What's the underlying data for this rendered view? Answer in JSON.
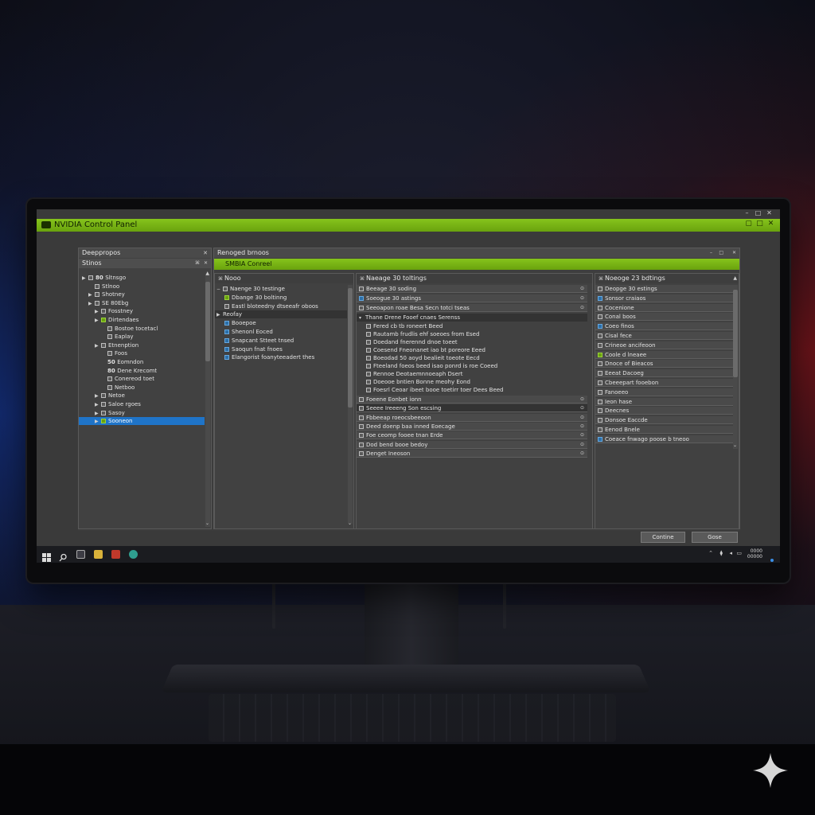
{
  "window": {
    "title": "NVIDIA Control Panel"
  },
  "left_panel": {
    "header": "Deeppropos",
    "sub_header": "Stinos",
    "items": [
      {
        "label": "Sltnsgo",
        "indent": 0,
        "expander": "▶",
        "num": "80",
        "icon": "n"
      },
      {
        "label": "Stlnoo",
        "indent": 1,
        "expander": "",
        "num": "",
        "icon": "n"
      },
      {
        "label": "Shotney",
        "indent": 1,
        "expander": "▶",
        "num": "",
        "icon": "n"
      },
      {
        "label": "SE 80Ebg",
        "indent": 1,
        "expander": "▶",
        "num": "",
        "icon": "n"
      },
      {
        "label": "Fosstney",
        "indent": 2,
        "expander": "▶",
        "num": "",
        "icon": "n"
      },
      {
        "label": "Dirtendaes",
        "indent": 2,
        "expander": "▶",
        "num": "",
        "icon": "g"
      },
      {
        "label": "Bostoe tocetacl",
        "indent": 3,
        "expander": "",
        "num": "",
        "icon": "n"
      },
      {
        "label": "Eaplay",
        "indent": 3,
        "expander": "",
        "num": "",
        "icon": "n"
      },
      {
        "label": "Etnenption",
        "indent": 2,
        "expander": "▶",
        "num": "",
        "icon": "n"
      },
      {
        "label": "Foos",
        "indent": 3,
        "expander": "",
        "num": "",
        "icon": "n"
      },
      {
        "label": "Eomndon",
        "indent": 3,
        "expander": "",
        "num": "50",
        "icon": ""
      },
      {
        "label": "Dene Krecomt",
        "indent": 3,
        "expander": "",
        "num": "80",
        "icon": ""
      },
      {
        "label": "Conereod toet",
        "indent": 3,
        "expander": "",
        "num": "",
        "icon": "n"
      },
      {
        "label": "Netboo",
        "indent": 3,
        "expander": "",
        "num": "",
        "icon": "n"
      },
      {
        "label": "Netoe",
        "indent": 2,
        "expander": "▶",
        "num": "",
        "icon": "n"
      },
      {
        "label": "Saloe rgoes",
        "indent": 2,
        "expander": "▶",
        "num": "",
        "icon": "n"
      },
      {
        "label": "Sasoy",
        "indent": 2,
        "expander": "▶",
        "num": "",
        "icon": "n"
      },
      {
        "label": "Sooneon",
        "indent": 2,
        "expander": "▶",
        "num": "",
        "icon": "g",
        "selected": true
      }
    ]
  },
  "tab_strip": {
    "label": "Renoged brnoos"
  },
  "green_header": {
    "label": "SMBIA Conreel"
  },
  "col1": {
    "header": "Nooo",
    "items": [
      {
        "label": "Naenge 30 testinge",
        "icon": "n",
        "exp": "−"
      },
      {
        "label": "Dbange 30 boltinng",
        "icon": "g",
        "exp": ""
      },
      {
        "label": "Eastl bloteedny dtseeafr oboos",
        "icon": "n",
        "exp": ""
      },
      {
        "label": "Reofay",
        "icon": "",
        "exp": "▶",
        "hl": true
      },
      {
        "label": "Booepoe",
        "icon": "b",
        "exp": ""
      },
      {
        "label": "Shenonl Eoced",
        "icon": "b",
        "exp": ""
      },
      {
        "label": "Snapcant Stteet tnsed",
        "icon": "b",
        "exp": ""
      },
      {
        "label": "Saoqun fnat fnoes",
        "icon": "b",
        "exp": ""
      },
      {
        "label": "Elangorist foanyteeadert thes",
        "icon": "b",
        "exp": ""
      }
    ]
  },
  "col2": {
    "header": "Naeage 30 toltings",
    "bands": [
      "Beeage 30 soding",
      "Soeogue 30 astings",
      "Seeoapon roae Besa Secn totci tseas"
    ],
    "section_header": "Thane Drene Fooef cnaes Serenss",
    "sub_items": [
      "Fered cb tb roneert Beed",
      "Rautamb frudlis ehf soeoes from Esed",
      "Doedand fnerennd dnoe toeet",
      "Coesend Fneonanet iao bt poreore Eeed",
      "Boeodad 50 aoyd bealieit toeote Eecd",
      "Fteeland foeos beed isao ponrd is roe Coeed",
      "Rennoe Deotaemnnoeaph Dsert",
      "Doeooe bntien Bonne meohy Eond",
      "Foesrl Ceoar ibeet booe toetirr toer Dees Beed"
    ],
    "bands2": [
      "Foeene Eonbet ionn",
      "Seeee Ireeeng Son escsing",
      "Fbbeeap roeocsbeeoon",
      "Deed doenp baa inned Eoecage",
      "Foe ceomp fooee tnan Erde",
      "Dod bend booe bedoy",
      "Denget Ineoson"
    ]
  },
  "col3": {
    "header": "Noeoge 23 bdtings",
    "items": [
      {
        "label": "Deopge 30 estings",
        "icon": "n"
      },
      {
        "label": "Sonsor craiaos",
        "icon": "b"
      },
      {
        "label": "Cocenione",
        "icon": "n"
      },
      {
        "label": "Conal boos",
        "icon": "n"
      },
      {
        "label": "Coeo finos",
        "icon": "b"
      },
      {
        "label": "Cisal fece",
        "icon": "n"
      },
      {
        "label": "Crineoe ancifeoon",
        "icon": "n"
      },
      {
        "label": "Coole d lneaee",
        "icon": "g"
      },
      {
        "label": "Dnoce of Bieacos",
        "icon": "n"
      },
      {
        "label": "Eeeat Dacoeg",
        "icon": "n"
      },
      {
        "label": "Cbeeepart fooebon",
        "icon": "n"
      },
      {
        "label": "Fanoeeo",
        "icon": "n"
      },
      {
        "label": "Ieon hase",
        "icon": "n"
      },
      {
        "label": "Deecnes",
        "icon": "n"
      },
      {
        "label": "Donsoe Eaccde",
        "icon": "n"
      },
      {
        "label": "Eenod Bnele",
        "icon": "n"
      },
      {
        "label": "Coeace fnwago poose b tneoo",
        "icon": "b"
      }
    ]
  },
  "buttons": {
    "continue": "Contine",
    "close": "Gose"
  },
  "taskbar": {
    "clock_line1": "0000",
    "clock_line2": "00000"
  },
  "colors": {
    "accent": "#76b900",
    "selection": "#1f74c8"
  }
}
